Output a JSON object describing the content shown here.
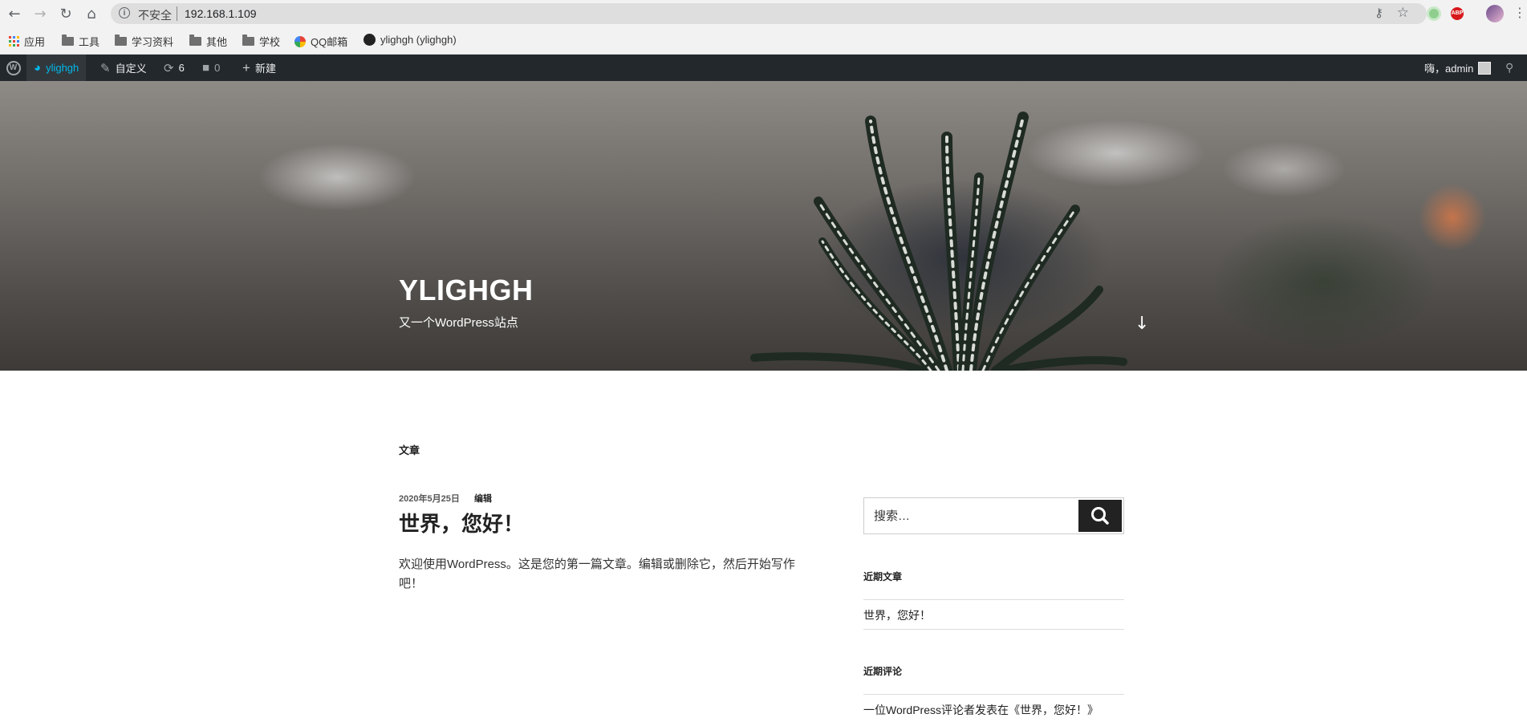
{
  "browser": {
    "security_label": "不安全",
    "url": "192.168.1.109",
    "bookmarks": [
      "应用",
      "工具",
      "学习资料",
      "其他",
      "学校",
      "QQ邮箱",
      "ylighgh (ylighgh)"
    ],
    "extensions": {
      "abp_label": "ABP"
    }
  },
  "adminbar": {
    "site_name": "ylighgh",
    "customize": "自定义",
    "updates_count": "6",
    "comments_count": "0",
    "new": "新建",
    "greeting": "嗨，admin"
  },
  "hero": {
    "title": "YLIGHGH",
    "tagline": "又一个WordPress站点"
  },
  "main": {
    "section_heading": "文章",
    "post": {
      "date": "2020年5月25日",
      "edit": "编辑",
      "title": "世界，您好！",
      "excerpt": "欢迎使用WordPress。这是您的第一篇文章。编辑或删除它，然后开始写作吧！"
    }
  },
  "sidebar": {
    "search_placeholder": "搜索…",
    "recent_posts_title": "近期文章",
    "recent_posts": [
      "世界，您好！"
    ],
    "recent_comments_title": "近期评论",
    "recent_comments": [
      "一位WordPress评论者发表在《世界，您好！》"
    ]
  },
  "colors": {
    "admin_bar": "#23282d",
    "accent": "#00b9eb",
    "button_dark": "#222222"
  }
}
